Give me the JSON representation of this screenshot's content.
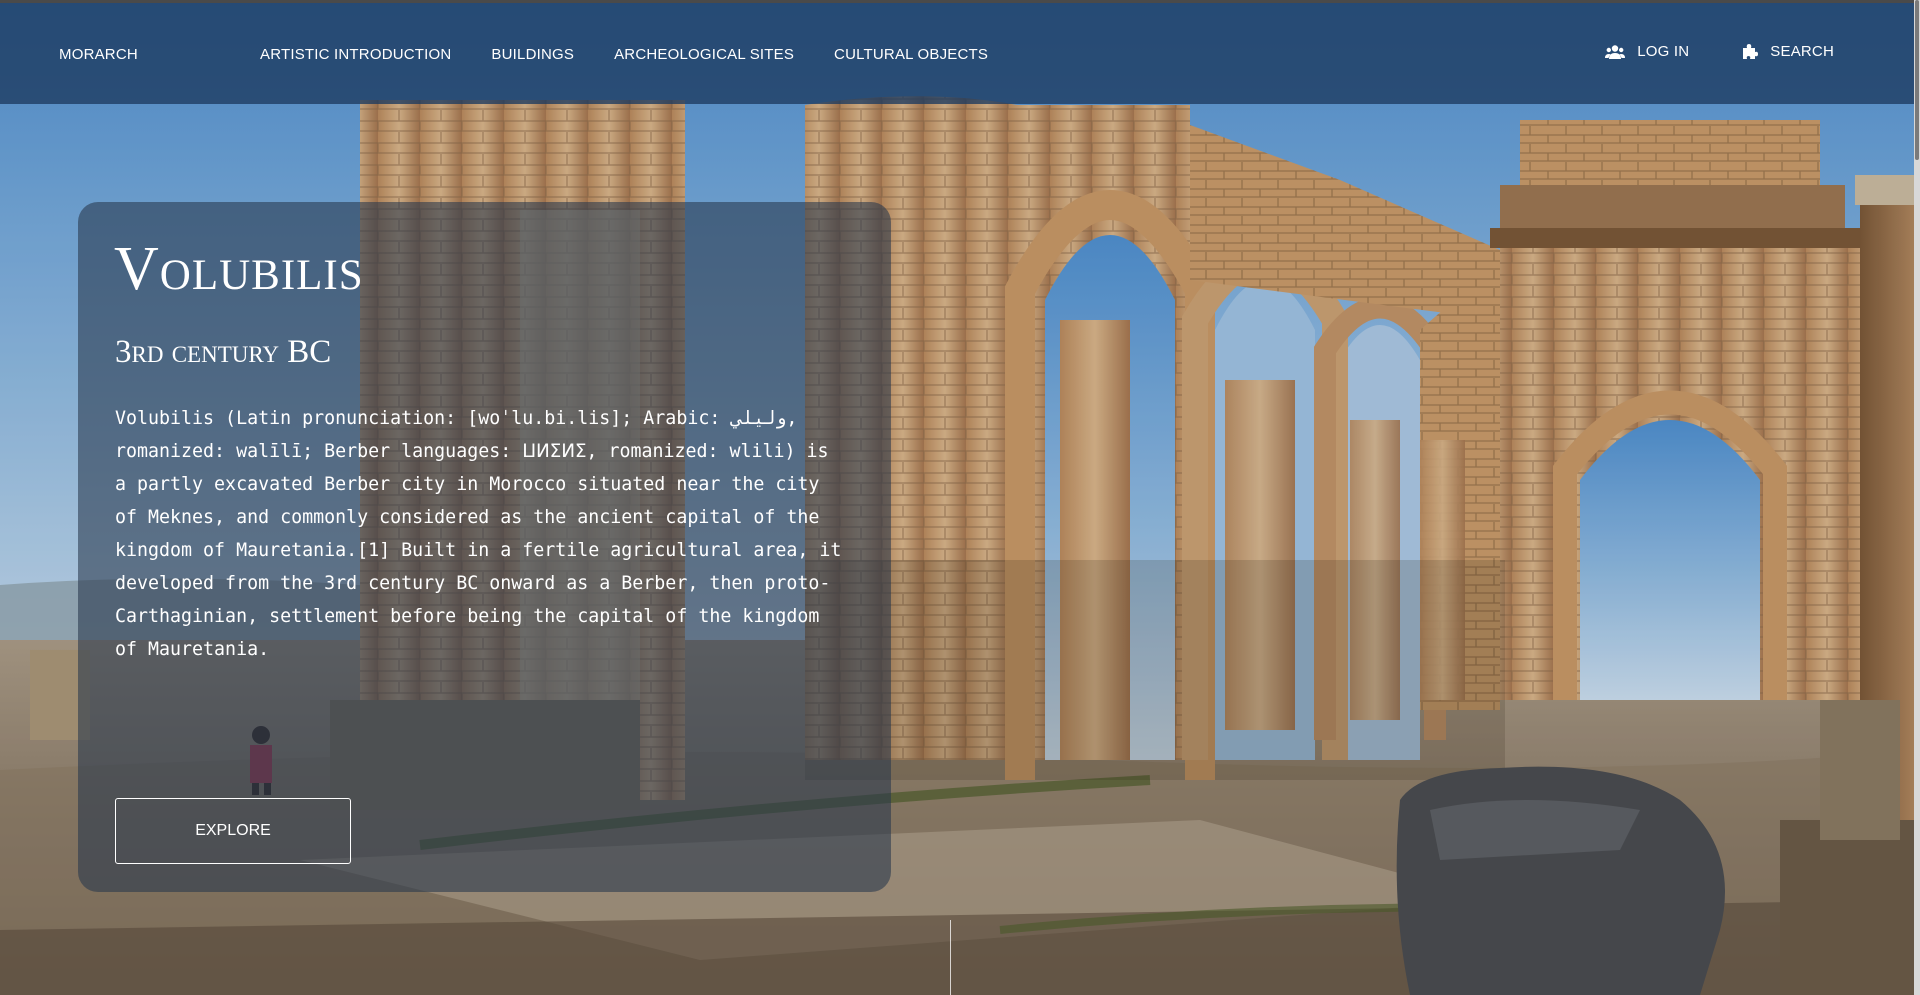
{
  "nav": {
    "brand": "MORARCH",
    "links": [
      "ARTISTIC INTRODUCTION",
      "BUILDINGS",
      "ARCHEOLOGICAL SITES",
      "CULTURAL OBJECTS"
    ],
    "login_label": "LOG IN",
    "login_icon": "users-icon",
    "search_label": "SEARCH",
    "search_icon": "puzzle-icon"
  },
  "hero": {
    "background": "photo of Volubilis Roman ruins with brick and stone arches under a blue sky",
    "title": "Volubilis",
    "subtitle": "3rd century BC",
    "description": "Volubilis (Latin pronunciation: [woˈlu.bi.lis]; Arabic: وليلي, romanized: walīlī; Berber languages: ⵡⵍⵉⵍⵉ, romanized: wlili) is a partly excavated Berber city in Morocco situated near the city of Meknes, and commonly considered as the ancient capital of the kingdom of Mauretania.[1] Built in a fertile agricultural area, it developed from the 3rd century BC onward as a Berber, then proto-Carthaginian, settlement before being the capital of the kingdom of Mauretania.",
    "explore_label": "EXPLORE"
  },
  "colors": {
    "nav_bg": "#1c3a5f",
    "card_bg": "#28374b",
    "text": "#ffffff"
  }
}
